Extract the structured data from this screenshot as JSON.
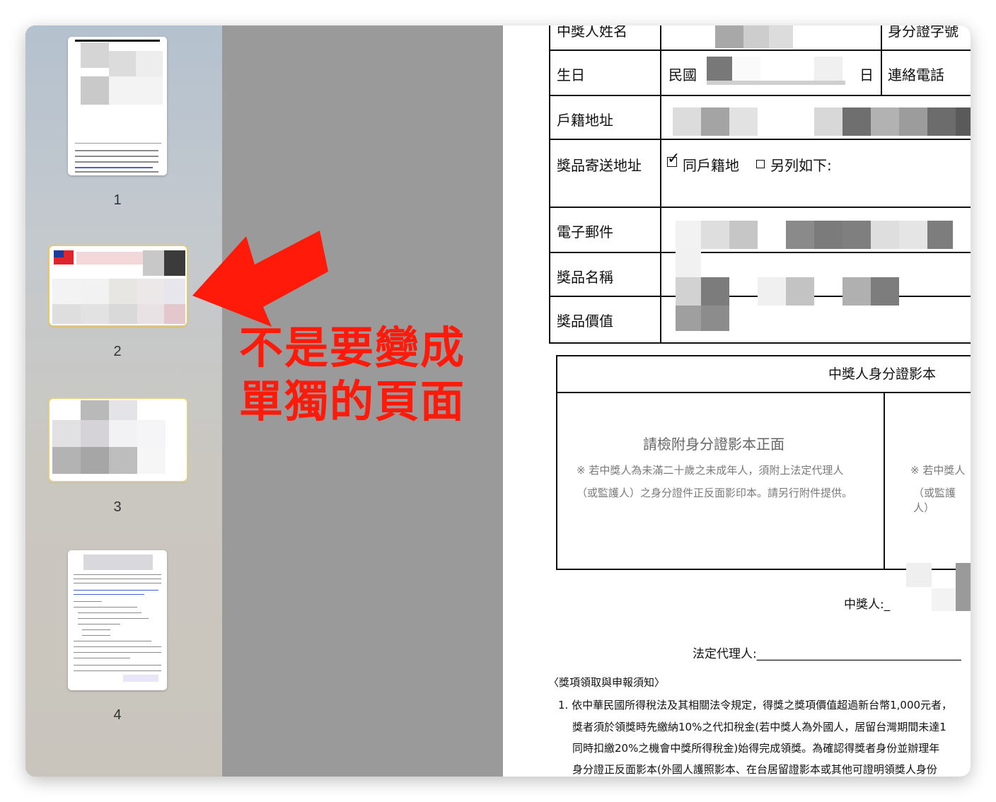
{
  "sidebar": {
    "pages": [
      {
        "number": "1"
      },
      {
        "number": "2"
      },
      {
        "number": "3"
      },
      {
        "number": "4"
      }
    ]
  },
  "annotation": {
    "line1": "不是要變成",
    "line2": "單獨的頁面",
    "color": "#ff1a0a"
  },
  "form": {
    "row_name": "中獎人姓名",
    "row_id": "身分證字號",
    "row_birthday": "生日",
    "birthday_prefix": "民國",
    "birthday_suffix": "日",
    "row_phone": "連絡電話",
    "row_address": "戶籍地址",
    "row_ship": "獎品寄送地址",
    "ship_same": "同戶籍地",
    "ship_other": "另列如下:",
    "row_email": "電子郵件",
    "row_prize_name": "獎品名稱",
    "row_prize_value": "獎品價值",
    "id_copy_title": "中獎人身分證影本",
    "id_front_title": "請檢附身分證影本正面",
    "id_note_line1": "※ 若中獎人為未滿二十歲之未成年人，須附上法定代理人",
    "id_note_line2": "（或監護人）之身分證件正反面影印本。請另行附件提供。",
    "id_note_right1": "※ 若中獎人",
    "id_note_right2": "（或監護人）",
    "winner_sign": "中獎人:_",
    "guardian_sign": "法定代理人:__________________________________",
    "notice_title": "〈獎項領取與申報須知〉",
    "notice_1a": "1.  依中華民國所得稅法及其相關法令規定，得獎之獎項價值超過新台幣1,000元者，",
    "notice_1b": "獎者須於領獎時先繳納10%之代扣稅金(若中獎人為外國人，居留台灣期間未達1",
    "notice_1c": "同時扣繳20%之機會中獎所得稅金)始得完成領獎。為確認得獎者身份並辦理年",
    "notice_1d": "身分證正反面影本(外國人護照影本、在台居留證影本或其他可證明領獎人身份"
  }
}
